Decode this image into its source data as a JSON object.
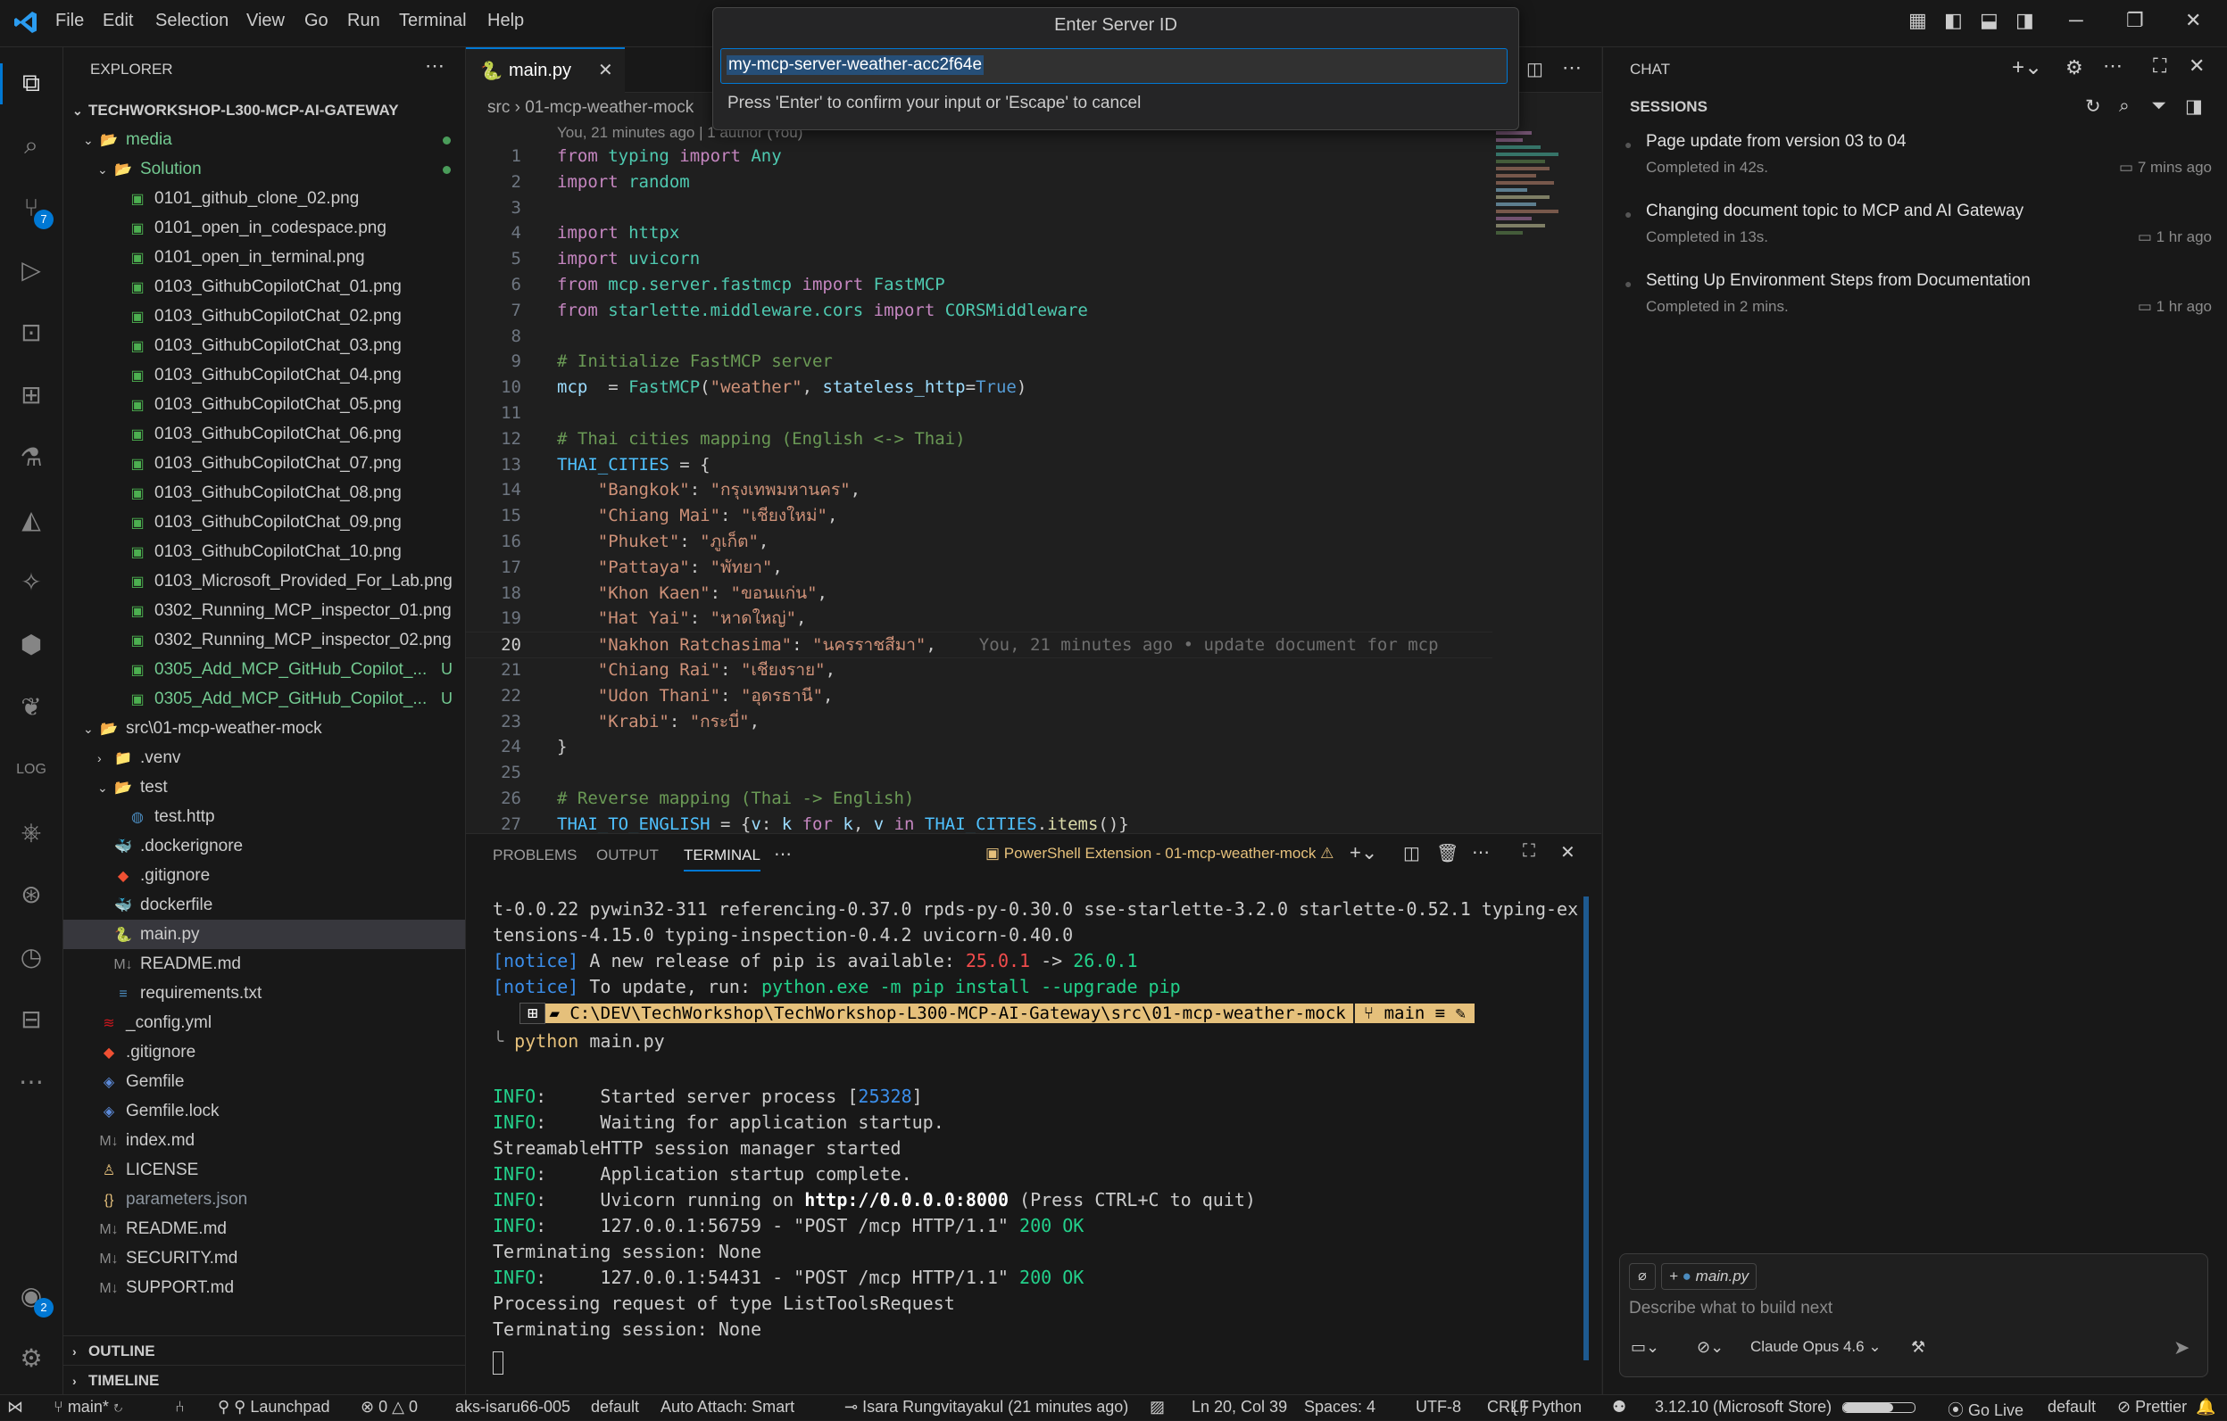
{
  "menu": [
    "File",
    "Edit",
    "Selection",
    "View",
    "Go",
    "Run",
    "Terminal",
    "Help"
  ],
  "quick_input": {
    "title": "Enter Server ID",
    "value": "my-mcp-server-weather-acc2f64e",
    "hint": "Press 'Enter' to confirm your input or 'Escape' to cancel"
  },
  "activity": {
    "scm_badge": "7",
    "accounts_badge": "2"
  },
  "explorer": {
    "header": "EXPLORER",
    "root": "TECHWORKSHOP-L300-MCP-AI-GATEWAY",
    "rows": [
      {
        "label": "media",
        "indent": 1,
        "type": "folder-open",
        "color": "#73c991",
        "dot": true
      },
      {
        "label": "Solution",
        "indent": 2,
        "type": "folder-open",
        "color": "#73c991",
        "dot": true
      },
      {
        "label": "0101_github_clone_02.png",
        "indent": 3,
        "type": "img"
      },
      {
        "label": "0101_open_in_codespace.png",
        "indent": 3,
        "type": "img"
      },
      {
        "label": "0101_open_in_terminal.png",
        "indent": 3,
        "type": "img"
      },
      {
        "label": "0103_GithubCopilotChat_01.png",
        "indent": 3,
        "type": "img"
      },
      {
        "label": "0103_GithubCopilotChat_02.png",
        "indent": 3,
        "type": "img"
      },
      {
        "label": "0103_GithubCopilotChat_03.png",
        "indent": 3,
        "type": "img"
      },
      {
        "label": "0103_GithubCopilotChat_04.png",
        "indent": 3,
        "type": "img"
      },
      {
        "label": "0103_GithubCopilotChat_05.png",
        "indent": 3,
        "type": "img"
      },
      {
        "label": "0103_GithubCopilotChat_06.png",
        "indent": 3,
        "type": "img"
      },
      {
        "label": "0103_GithubCopilotChat_07.png",
        "indent": 3,
        "type": "img"
      },
      {
        "label": "0103_GithubCopilotChat_08.png",
        "indent": 3,
        "type": "img"
      },
      {
        "label": "0103_GithubCopilotChat_09.png",
        "indent": 3,
        "type": "img"
      },
      {
        "label": "0103_GithubCopilotChat_10.png",
        "indent": 3,
        "type": "img"
      },
      {
        "label": "0103_Microsoft_Provided_For_Lab.png",
        "indent": 3,
        "type": "img"
      },
      {
        "label": "0302_Running_MCP_inspector_01.png",
        "indent": 3,
        "type": "img"
      },
      {
        "label": "0302_Running_MCP_inspector_02.png",
        "indent": 3,
        "type": "img"
      },
      {
        "label": "0305_Add_MCP_GitHub_Copilot_...",
        "indent": 3,
        "type": "img",
        "color": "#73c991",
        "u": "U"
      },
      {
        "label": "0305_Add_MCP_GitHub_Copilot_...",
        "indent": 3,
        "type": "img",
        "color": "#73c991",
        "u": "U"
      },
      {
        "label": "src\\01-mcp-weather-mock",
        "indent": 1,
        "type": "folder-open"
      },
      {
        "label": ".venv",
        "indent": 2,
        "type": "folder"
      },
      {
        "label": "test",
        "indent": 2,
        "type": "folder-open"
      },
      {
        "label": "test.http",
        "indent": 3,
        "type": "http"
      },
      {
        "label": ".dockerignore",
        "indent": 2,
        "type": "docker"
      },
      {
        "label": ".gitignore",
        "indent": 2,
        "type": "git"
      },
      {
        "label": "dockerfile",
        "indent": 2,
        "type": "docker"
      },
      {
        "label": "main.py",
        "indent": 2,
        "type": "py",
        "selected": true
      },
      {
        "label": "README.md",
        "indent": 2,
        "type": "md"
      },
      {
        "label": "requirements.txt",
        "indent": 2,
        "type": "txt"
      },
      {
        "label": "_config.yml",
        "indent": 1,
        "type": "yml"
      },
      {
        "label": ".gitignore",
        "indent": 1,
        "type": "git"
      },
      {
        "label": "Gemfile",
        "indent": 1,
        "type": "gem"
      },
      {
        "label": "Gemfile.lock",
        "indent": 1,
        "type": "gem"
      },
      {
        "label": "index.md",
        "indent": 1,
        "type": "md"
      },
      {
        "label": "LICENSE",
        "indent": 1,
        "type": "license"
      },
      {
        "label": "parameters.json",
        "indent": 1,
        "type": "json",
        "color": "#8b949e"
      },
      {
        "label": "README.md",
        "indent": 1,
        "type": "md"
      },
      {
        "label": "SECURITY.md",
        "indent": 1,
        "type": "md"
      },
      {
        "label": "SUPPORT.md",
        "indent": 1,
        "type": "md"
      }
    ],
    "outline": "OUTLINE",
    "timeline": "TIMELINE"
  },
  "editor": {
    "tab": "main.py",
    "breadcrumb_src": "src",
    "breadcrumb_folder": "01-mcp-weather-mock",
    "blame_header": "You, 21 minutes ago | 1 author (You)",
    "inline_blame": "You, 21 minutes ago • update document for mcp",
    "current_line": 20,
    "lines": [
      {
        "n": "1",
        "t": [
          [
            "kw",
            "from "
          ],
          [
            "cls",
            "typing "
          ],
          [
            "kw",
            "import "
          ],
          [
            "cls",
            "Any"
          ]
        ]
      },
      {
        "n": "2",
        "t": [
          [
            "kw",
            "import "
          ],
          [
            "cls",
            "random"
          ]
        ]
      },
      {
        "n": "3",
        "t": []
      },
      {
        "n": "4",
        "t": [
          [
            "kw",
            "import "
          ],
          [
            "cls",
            "httpx"
          ]
        ]
      },
      {
        "n": "5",
        "t": [
          [
            "kw",
            "import "
          ],
          [
            "cls",
            "uvicorn"
          ]
        ]
      },
      {
        "n": "6",
        "t": [
          [
            "kw",
            "from "
          ],
          [
            "cls",
            "mcp.server.fastmcp "
          ],
          [
            "kw",
            "import "
          ],
          [
            "cls",
            "FastMCP"
          ]
        ]
      },
      {
        "n": "7",
        "t": [
          [
            "kw",
            "from "
          ],
          [
            "cls",
            "starlette.middleware.cors "
          ],
          [
            "kw",
            "import "
          ],
          [
            "cls",
            "CORSMiddleware"
          ]
        ]
      },
      {
        "n": "8",
        "t": []
      },
      {
        "n": "9",
        "t": [
          [
            "cm",
            "# Initialize FastMCP server"
          ]
        ]
      },
      {
        "n": "10",
        "t": [
          [
            "var",
            "mcp"
          ],
          [
            "",
            "  = "
          ],
          [
            "cls",
            "FastMCP"
          ],
          [
            "",
            "("
          ],
          [
            "str",
            "\"weather\""
          ],
          [
            "",
            ", "
          ],
          [
            "var",
            "stateless_http"
          ],
          [
            "",
            "="
          ],
          [
            "bool",
            "True"
          ],
          [
            "",
            ")"
          ]
        ]
      },
      {
        "n": "11",
        "t": []
      },
      {
        "n": "12",
        "t": [
          [
            "cm",
            "# Thai cities mapping (English <-> Thai)"
          ]
        ]
      },
      {
        "n": "13",
        "t": [
          [
            "con",
            "THAI_CITIES"
          ],
          [
            "",
            " = {"
          ]
        ]
      },
      {
        "n": "14",
        "t": [
          [
            "",
            "    "
          ],
          [
            "str",
            "\"Bangkok\""
          ],
          [
            "",
            ": "
          ],
          [
            "str",
            "\"กรุงเทพมหานคร\""
          ],
          [
            "",
            ","
          ]
        ]
      },
      {
        "n": "15",
        "t": [
          [
            "",
            "    "
          ],
          [
            "str",
            "\"Chiang Mai\""
          ],
          [
            "",
            ": "
          ],
          [
            "str",
            "\"เชียงใหม่\""
          ],
          [
            "",
            ","
          ]
        ]
      },
      {
        "n": "16",
        "t": [
          [
            "",
            "    "
          ],
          [
            "str",
            "\"Phuket\""
          ],
          [
            "",
            ": "
          ],
          [
            "str",
            "\"ภูเก็ต\""
          ],
          [
            "",
            ","
          ]
        ]
      },
      {
        "n": "17",
        "t": [
          [
            "",
            "    "
          ],
          [
            "str",
            "\"Pattaya\""
          ],
          [
            "",
            ": "
          ],
          [
            "str",
            "\"พัทยา\""
          ],
          [
            "",
            ","
          ]
        ]
      },
      {
        "n": "18",
        "t": [
          [
            "",
            "    "
          ],
          [
            "str",
            "\"Khon Kaen\""
          ],
          [
            "",
            ": "
          ],
          [
            "str",
            "\"ขอนแก่น\""
          ],
          [
            "",
            ","
          ]
        ]
      },
      {
        "n": "19",
        "t": [
          [
            "",
            "    "
          ],
          [
            "str",
            "\"Hat Yai\""
          ],
          [
            "",
            ": "
          ],
          [
            "str",
            "\"หาดใหญ่\""
          ],
          [
            "",
            ","
          ]
        ]
      },
      {
        "n": "20",
        "t": [
          [
            "",
            "    "
          ],
          [
            "str",
            "\"Nakhon Ratchasima\""
          ],
          [
            "",
            ": "
          ],
          [
            "str",
            "\"นครราชสีมา\""
          ],
          [
            "",
            ","
          ]
        ]
      },
      {
        "n": "21",
        "t": [
          [
            "",
            "    "
          ],
          [
            "str",
            "\"Chiang Rai\""
          ],
          [
            "",
            ": "
          ],
          [
            "str",
            "\"เชียงราย\""
          ],
          [
            "",
            ","
          ]
        ]
      },
      {
        "n": "22",
        "t": [
          [
            "",
            "    "
          ],
          [
            "str",
            "\"Udon Thani\""
          ],
          [
            "",
            ": "
          ],
          [
            "str",
            "\"อุดรธานี\""
          ],
          [
            "",
            ","
          ]
        ]
      },
      {
        "n": "23",
        "t": [
          [
            "",
            "    "
          ],
          [
            "str",
            "\"Krabi\""
          ],
          [
            "",
            ": "
          ],
          [
            "str",
            "\"กระบี่\""
          ],
          [
            "",
            ","
          ]
        ]
      },
      {
        "n": "24",
        "t": [
          [
            "",
            "}"
          ]
        ]
      },
      {
        "n": "25",
        "t": []
      },
      {
        "n": "26",
        "t": [
          [
            "cm",
            "# Reverse mapping (Thai -> English)"
          ]
        ]
      },
      {
        "n": "27",
        "t": [
          [
            "con",
            "THAI_TO_ENGLISH"
          ],
          [
            "",
            " = {"
          ],
          [
            "var",
            "v"
          ],
          [
            "",
            ": "
          ],
          [
            "var",
            "k "
          ],
          [
            "kw",
            "for "
          ],
          [
            "var",
            "k"
          ],
          [
            "",
            ", "
          ],
          [
            "var",
            "v "
          ],
          [
            "kw",
            "in "
          ],
          [
            "con",
            "THAI_CITIES"
          ],
          [
            "",
            "."
          ],
          [
            "fn",
            "items"
          ],
          [
            "",
            "()}"
          ]
        ]
      }
    ]
  },
  "panel": {
    "tabs": [
      "PROBLEMS",
      "OUTPUT",
      "TERMINAL"
    ],
    "active_tab": "TERMINAL",
    "terminal_name": "PowerShell Extension - 01-mcp-weather-mock",
    "prompt_path": "C:\\DEV\\TechWorkshop\\TechWorkshop-L300-MCP-AI-Gateway\\src\\01-mcp-weather-mock",
    "prompt_branch": "main ≡",
    "command": "python main.py",
    "lines_top": [
      [
        [
          "",
          "t-0.0.22 pywin32-311 referencing-0.37.0 rpds-py-0.30.0 sse-starlette-3.2.0 starlette-0.52.1 typing-ex"
        ]
      ],
      [
        [
          "",
          "tensions-4.15.0 typing-inspection-0.4.2 uvicorn-0.40.0"
        ]
      ],
      [
        [
          "blue",
          "["
        ],
        [
          "blue",
          "notice"
        ],
        [
          "blue",
          "]"
        ],
        [
          "",
          " A new release of pip is available: "
        ],
        [
          "red",
          "25.0.1"
        ],
        [
          "",
          " -> "
        ],
        [
          "green",
          "26.0.1"
        ]
      ],
      [
        [
          "blue",
          "["
        ],
        [
          "blue",
          "notice"
        ],
        [
          "blue",
          "]"
        ],
        [
          "",
          " To update, run: "
        ],
        [
          "green",
          "python.exe -m pip install --upgrade pip"
        ]
      ]
    ],
    "lines_bottom": [
      [
        [
          "green",
          "INFO"
        ],
        [
          "",
          ":     Started server process ["
        ],
        [
          "blue",
          "25328"
        ],
        [
          "",
          "]"
        ]
      ],
      [
        [
          "green",
          "INFO"
        ],
        [
          "",
          ":     Waiting for application startup."
        ]
      ],
      [
        [
          "",
          "StreamableHTTP session manager started"
        ]
      ],
      [
        [
          "green",
          "INFO"
        ],
        [
          "",
          ":     Application startup complete."
        ]
      ],
      [
        [
          "green",
          "INFO"
        ],
        [
          "",
          ":     Uvicorn running on "
        ],
        [
          "bold",
          "http://0.0.0.0:8000"
        ],
        [
          "",
          " (Press CTRL+C to quit)"
        ]
      ],
      [
        [
          "green",
          "INFO"
        ],
        [
          "",
          ":     127.0.0.1:56759 - \"POST /mcp HTTP/1.1\" "
        ],
        [
          "green",
          "200 OK"
        ]
      ],
      [
        [
          "",
          "Terminating session: None"
        ]
      ],
      [
        [
          "green",
          "INFO"
        ],
        [
          "",
          ":     127.0.0.1:54431 - \"POST /mcp HTTP/1.1\" "
        ],
        [
          "green",
          "200 OK"
        ]
      ],
      [
        [
          "",
          "Processing request of type ListToolsRequest"
        ]
      ],
      [
        [
          "",
          "Terminating session: None"
        ]
      ]
    ]
  },
  "chat": {
    "title": "CHAT",
    "sessions_header": "SESSIONS",
    "sessions": [
      {
        "title": "Page update from version 03 to 04",
        "status": "Completed in 42s.",
        "time": "7 mins ago"
      },
      {
        "title": "Changing document topic to MCP and AI Gateway",
        "status": "Completed in 13s.",
        "time": "1 hr ago"
      },
      {
        "title": "Setting Up Environment Steps from Documentation",
        "status": "Completed in 2 mins.",
        "time": "1 hr ago"
      }
    ],
    "context_file": "main.py",
    "placeholder": "Describe what to build next",
    "model": "Claude Opus 4.6"
  },
  "status": {
    "branch": "main*",
    "launchpad": "Launchpad",
    "errors": "0",
    "warnings": "0",
    "cluster": "aks-isaru66-005",
    "namespace": "default",
    "auto_attach": "Auto Attach: Smart",
    "blame": "Isara Rungvitayakul (21 minutes ago)",
    "position": "Ln 20, Col 39",
    "spaces": "Spaces: 4",
    "encoding": "UTF-8",
    "eol": "CRLF",
    "language": "Python",
    "python": "3.12.10 (Microsoft Store)",
    "golive": "Go Live",
    "profile": "default",
    "prettier": "Prettier"
  }
}
